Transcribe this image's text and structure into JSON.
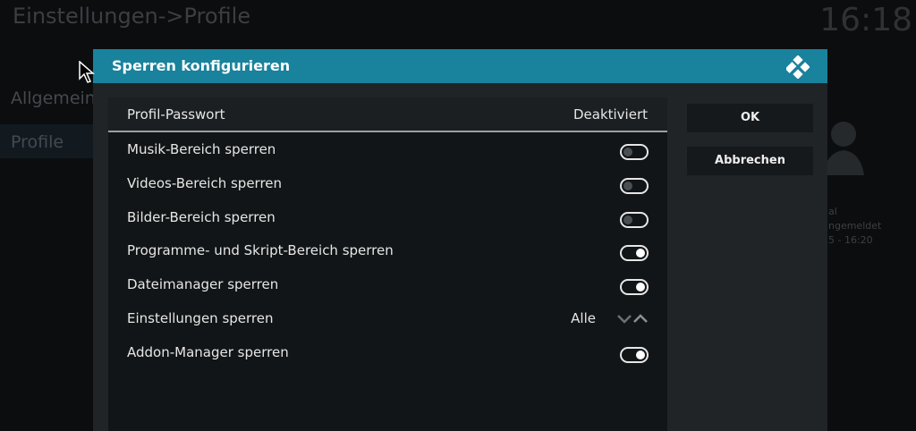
{
  "background": {
    "title": "Einstellungen->Profile",
    "clock": "16:18",
    "menu": [
      "Allgemein",
      "Profile"
    ],
    "info_lines": [
      "al",
      "ngemeldet",
      "5 - 16:20"
    ]
  },
  "dialog": {
    "title": "Sperren konfigurieren",
    "rows": [
      {
        "label": "Profil-Passwort",
        "value": "Deaktiviert"
      },
      {
        "label": "Musik-Bereich sperren",
        "toggle": false
      },
      {
        "label": "Videos-Bereich sperren",
        "toggle": false
      },
      {
        "label": "Bilder-Bereich sperren",
        "toggle": false
      },
      {
        "label": "Programme- und Skript-Bereich sperren",
        "toggle": true
      },
      {
        "label": "Dateimanager sperren",
        "toggle": true
      },
      {
        "label": "Einstellungen sperren",
        "value": "Alle"
      },
      {
        "label": "Addon-Manager sperren",
        "toggle": true
      }
    ],
    "buttons": {
      "ok": "OK",
      "cancel": "Abbrechen"
    }
  },
  "colors": {
    "header": "#19829c",
    "toggle_on": "#ffffff",
    "toggle_off": "#4a4f53"
  }
}
